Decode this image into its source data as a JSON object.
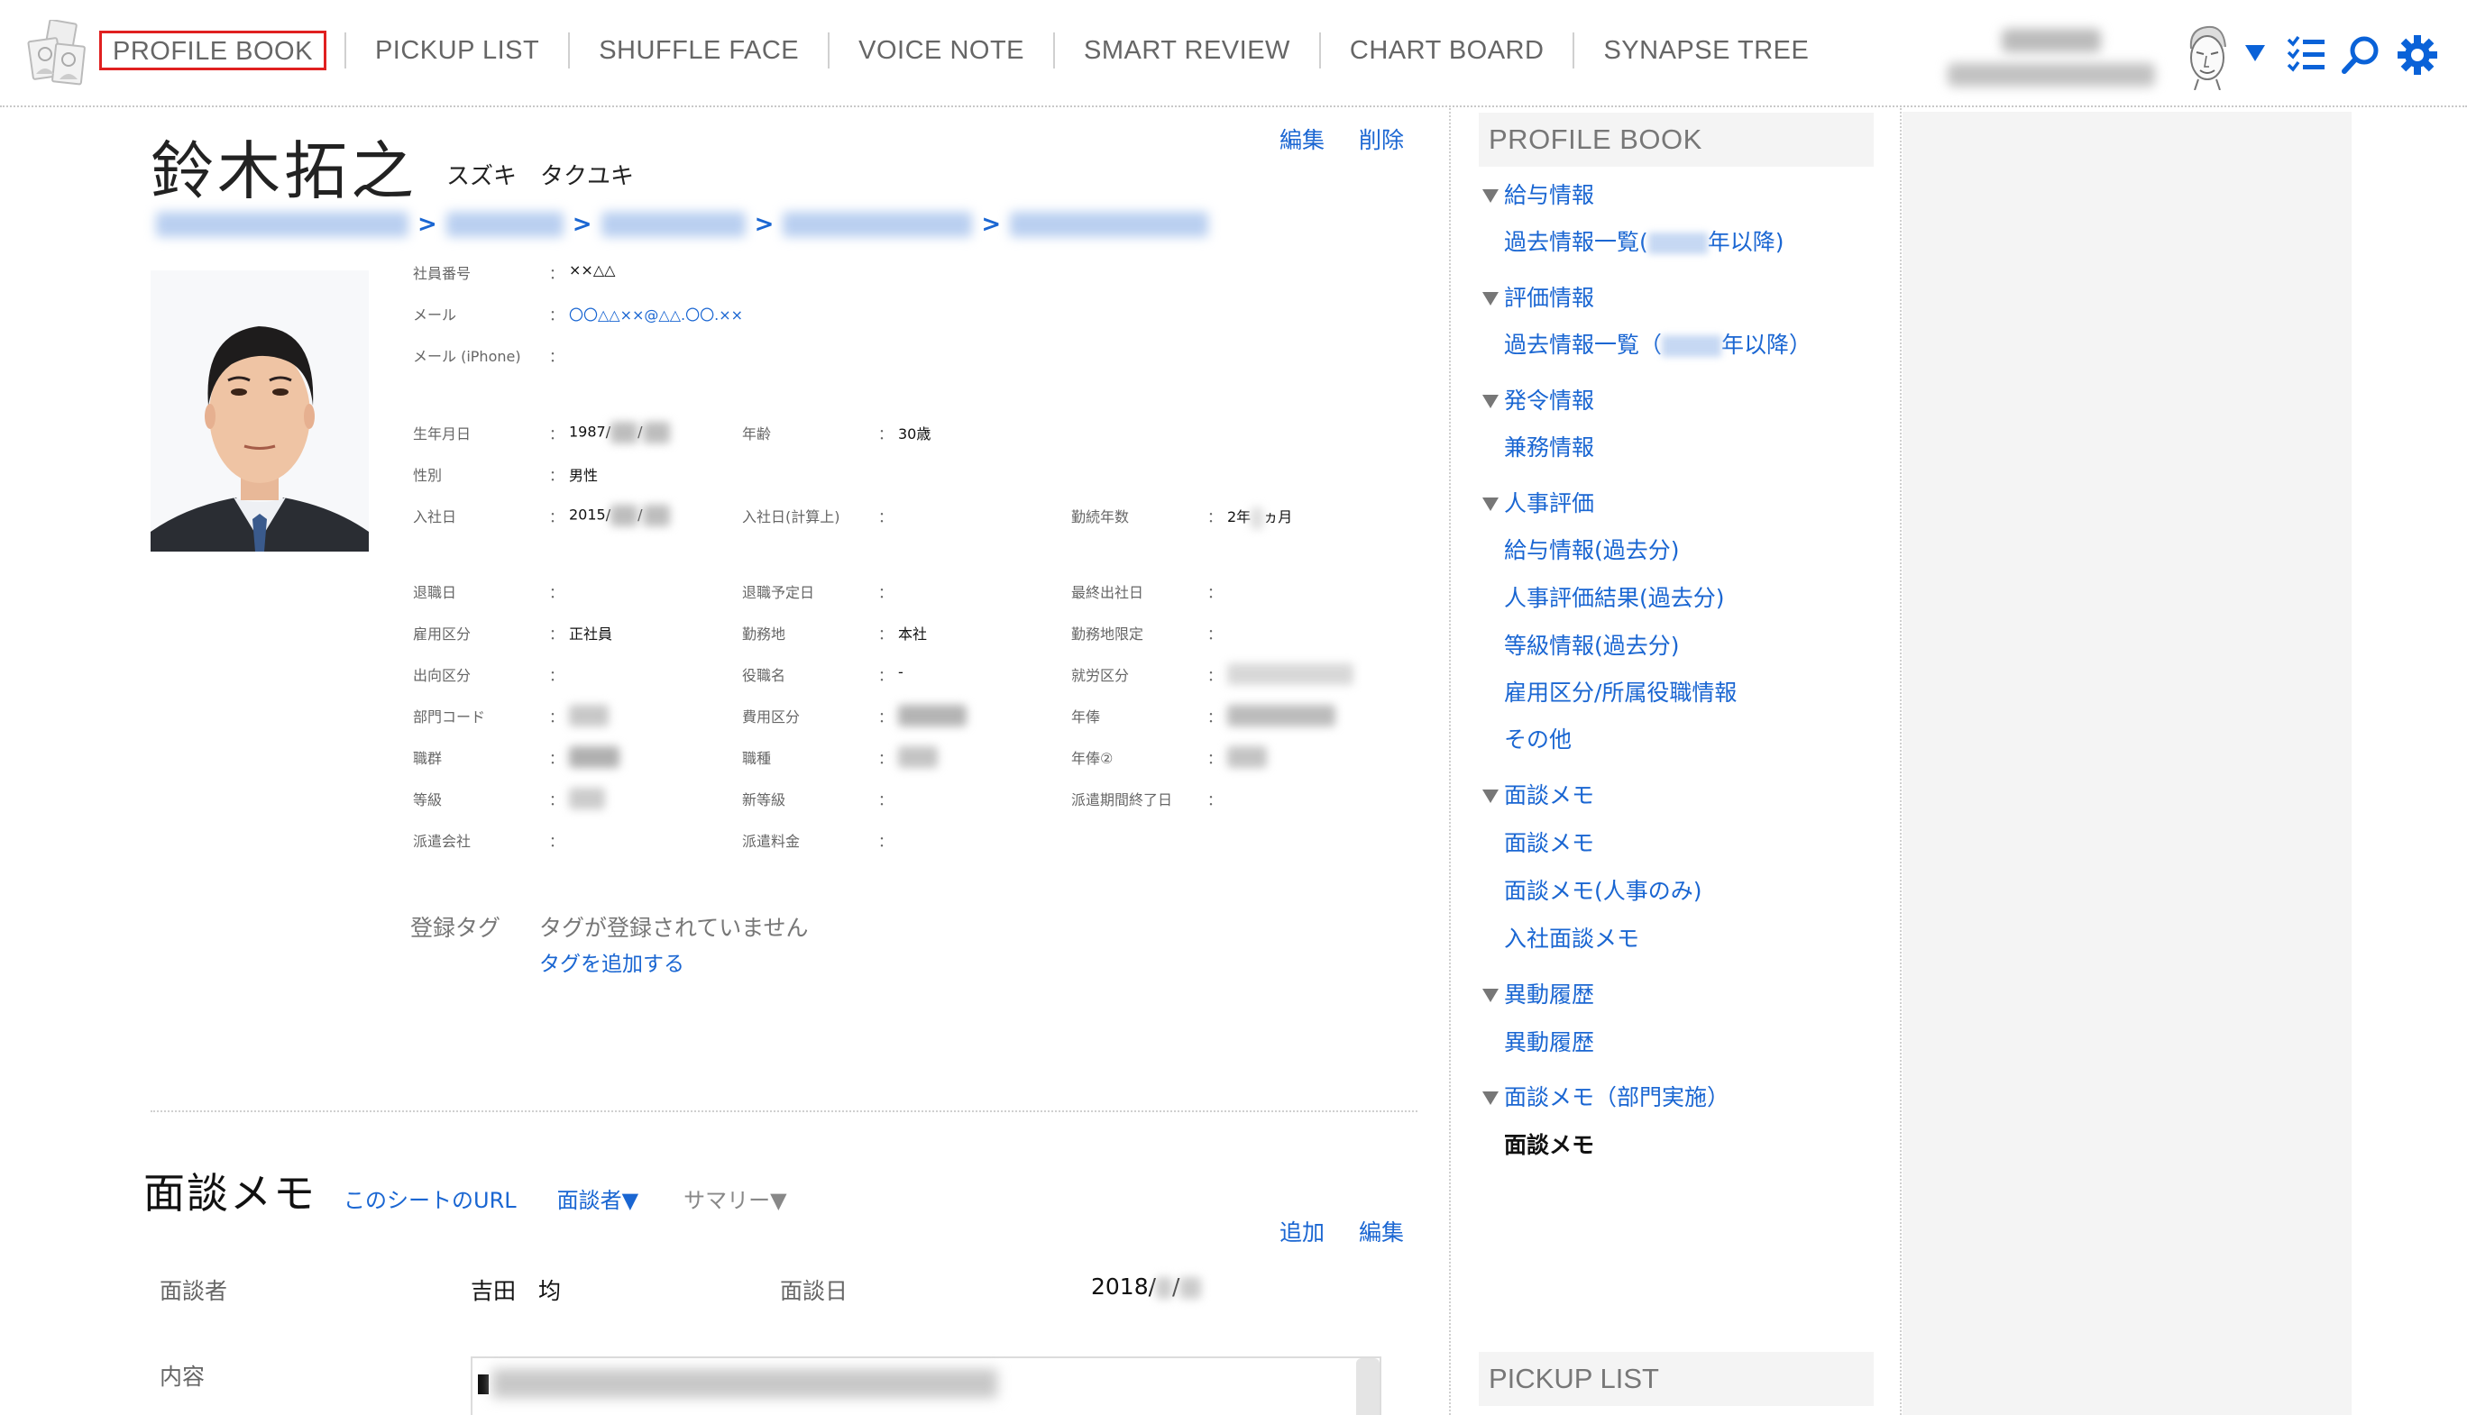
{
  "nav": {
    "items": [
      {
        "label": "PROFILE BOOK",
        "active": true
      },
      {
        "label": "PICKUP LIST"
      },
      {
        "label": "SHUFFLE FACE"
      },
      {
        "label": "VOICE NOTE"
      },
      {
        "label": "SMART REVIEW"
      },
      {
        "label": "CHART BOARD"
      },
      {
        "label": "SYNAPSE TREE"
      }
    ],
    "icons": [
      "user-avatar-icon",
      "dropdown-caret-icon",
      "checklist-icon",
      "search-icon",
      "gear-icon"
    ],
    "accent_color": "#0a62d8"
  },
  "profile": {
    "name": "鈴木拓之",
    "kana": "スズキ　タクユキ",
    "edit_label": "編集",
    "delete_label": "削除",
    "breadcrumb_separator": ">",
    "fields": {
      "emp_no": {
        "label": "社員番号",
        "value": "××△△"
      },
      "email": {
        "label": "メール",
        "value": "〇〇△△××@△△.〇〇.××"
      },
      "email_iphone": {
        "label": "メール (iPhone)",
        "value": ""
      },
      "birthdate": {
        "label": "生年月日",
        "value": "1987/"
      },
      "age": {
        "label": "年齢",
        "value": "30歳"
      },
      "gender": {
        "label": "性別",
        "value": "男性"
      },
      "join_date": {
        "label": "入社日",
        "value": "2015/"
      },
      "join_date_calc": {
        "label": "入社日(計算上)",
        "value": ""
      },
      "tenure": {
        "label": "勤続年数",
        "value_prefix": "2年",
        "value_suffix": "ヵ月"
      },
      "retire_date": {
        "label": "退職日",
        "value": ""
      },
      "retire_plan": {
        "label": "退職予定日",
        "value": ""
      },
      "last_day": {
        "label": "最終出社日",
        "value": ""
      },
      "employment": {
        "label": "雇用区分",
        "value": "正社員"
      },
      "location": {
        "label": "勤務地",
        "value": "本社"
      },
      "location_limit": {
        "label": "勤務地限定",
        "value": ""
      },
      "secondment": {
        "label": "出向区分",
        "value": ""
      },
      "title": {
        "label": "役職名",
        "value": "-"
      },
      "work_type": {
        "label": "就労区分",
        "value": ""
      },
      "dept_code": {
        "label": "部門コード",
        "value": ""
      },
      "cost_type": {
        "label": "費用区分",
        "value": ""
      },
      "salary": {
        "label": "年俸",
        "value": ""
      },
      "job_group": {
        "label": "職群",
        "value": ""
      },
      "job_type": {
        "label": "職種",
        "value": ""
      },
      "salary2": {
        "label": "年俸②",
        "value": ""
      },
      "grade": {
        "label": "等級",
        "value": ""
      },
      "new_grade": {
        "label": "新等級",
        "value": ""
      },
      "dispatch_end": {
        "label": "派遣期間終了日",
        "value": ""
      },
      "dispatch_co": {
        "label": "派遣会社",
        "value": ""
      },
      "dispatch_fee": {
        "label": "派遣料金",
        "value": ""
      }
    },
    "colon": "：",
    "tags": {
      "label": "登録タグ",
      "empty_text": "タグが登録されていません",
      "add_link": "タグを追加する"
    }
  },
  "memo": {
    "title": "面談メモ",
    "sheet_url_link": "このシートのURL",
    "interviewer_filter": "面談者▼",
    "summary_filter": "サマリー▼",
    "add_label": "追加",
    "edit_label": "編集",
    "interviewer_label": "面談者",
    "interviewer_value": "吉田　均",
    "date_label": "面談日",
    "date_value": "2018/",
    "content_label": "内容",
    "content_bullet": "■"
  },
  "sidebar": {
    "header": "PROFILE BOOK",
    "groups": [
      {
        "label": "給与情報",
        "children": [
          {
            "label_prefix": "過去情報一覧(",
            "label_suffix": "年以降)"
          }
        ]
      },
      {
        "label": "評価情報",
        "children": [
          {
            "label_prefix": "過去情報一覧（",
            "label_suffix": "年以降）"
          }
        ]
      },
      {
        "label": "発令情報",
        "children": [
          {
            "label": "兼務情報"
          }
        ]
      },
      {
        "label": "人事評価",
        "children": [
          {
            "label": "給与情報(過去分)"
          },
          {
            "label": "人事評価結果(過去分)"
          },
          {
            "label": "等級情報(過去分)"
          },
          {
            "label": "雇用区分/所属役職情報"
          },
          {
            "label": "その他"
          }
        ]
      },
      {
        "label": "面談メモ",
        "children": [
          {
            "label": "面談メモ"
          },
          {
            "label": "面談メモ(人事のみ)"
          },
          {
            "label": "入社面談メモ"
          }
        ]
      },
      {
        "label": "異動履歴",
        "children": [
          {
            "label": "異動履歴"
          }
        ]
      },
      {
        "label": "面談メモ（部門実施）",
        "children": [
          {
            "label": "面談メモ",
            "current": true
          }
        ]
      }
    ],
    "footer_header": "PICKUP LIST"
  }
}
